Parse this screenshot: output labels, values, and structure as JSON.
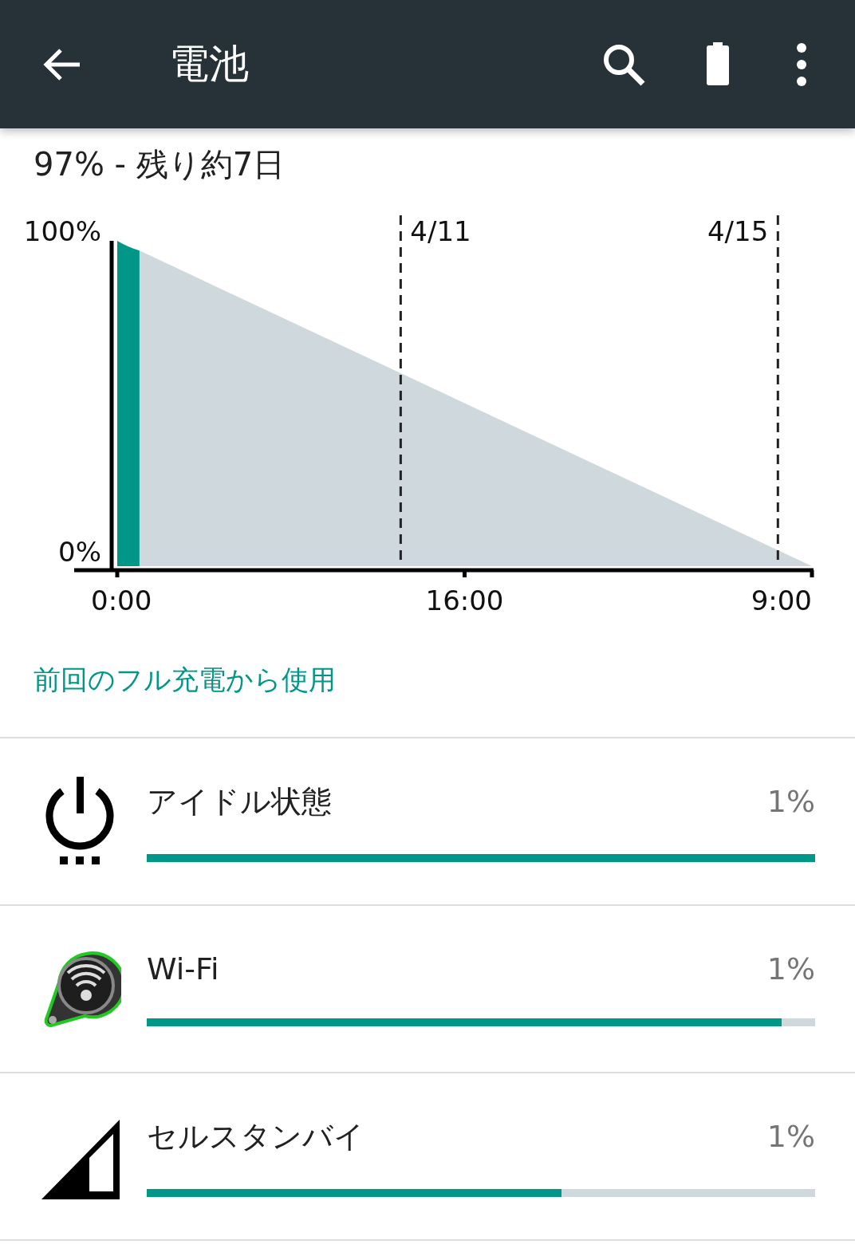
{
  "app_bar": {
    "title": "電池"
  },
  "summary": "97% - 残り約7日",
  "battery_graph": {
    "y_labels": [
      "100%",
      "0%"
    ],
    "x_labels": [
      "0:00",
      "16:00",
      "9:00"
    ],
    "date_markers": [
      "4/11",
      "4/15"
    ]
  },
  "section_header": "前回のフル充電から使用",
  "usage_items": [
    {
      "kind": "power",
      "label": "アイドル状態",
      "percent": "1%",
      "level": 1.0
    },
    {
      "kind": "wifi",
      "label": "Wi-Fi",
      "percent": "1%",
      "level": 0.95
    },
    {
      "kind": "signal",
      "label": "セルスタンバイ",
      "percent": "1%",
      "level": 0.62
    }
  ]
}
